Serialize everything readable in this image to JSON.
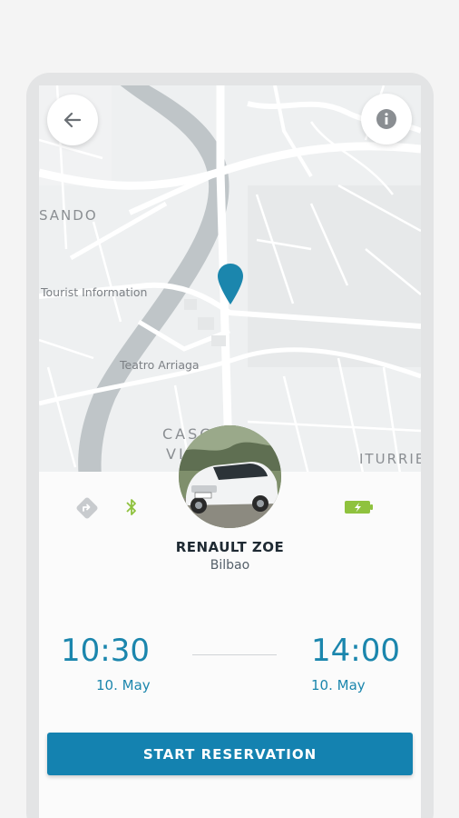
{
  "map": {
    "labels": {
      "area_left": "SANDO",
      "tourist_info": "Tourist Information",
      "teatro": "Teatro Arriaga",
      "casco_line1": "CASCO",
      "casco_line2": "VI",
      "iturri": "ITURRIE"
    },
    "pin_color": "#1b86ad"
  },
  "buttons": {
    "back_icon": "arrow-left-icon",
    "info_icon": "info-icon",
    "start_label": "START RESERVATION"
  },
  "vehicle": {
    "name": "RENAULT ZOE",
    "city": "Bilbao",
    "status_icons": [
      "route-icon",
      "bluetooth-icon",
      "battery-charging-icon"
    ]
  },
  "reservation": {
    "start_time": "10:30",
    "start_date": "10. May",
    "end_time": "14:00",
    "end_date": "10. May"
  },
  "colors": {
    "accent": "#1b86ad",
    "button": "#1482b0",
    "bluetooth": "#8fc23e",
    "battery": "#8fc23e"
  }
}
